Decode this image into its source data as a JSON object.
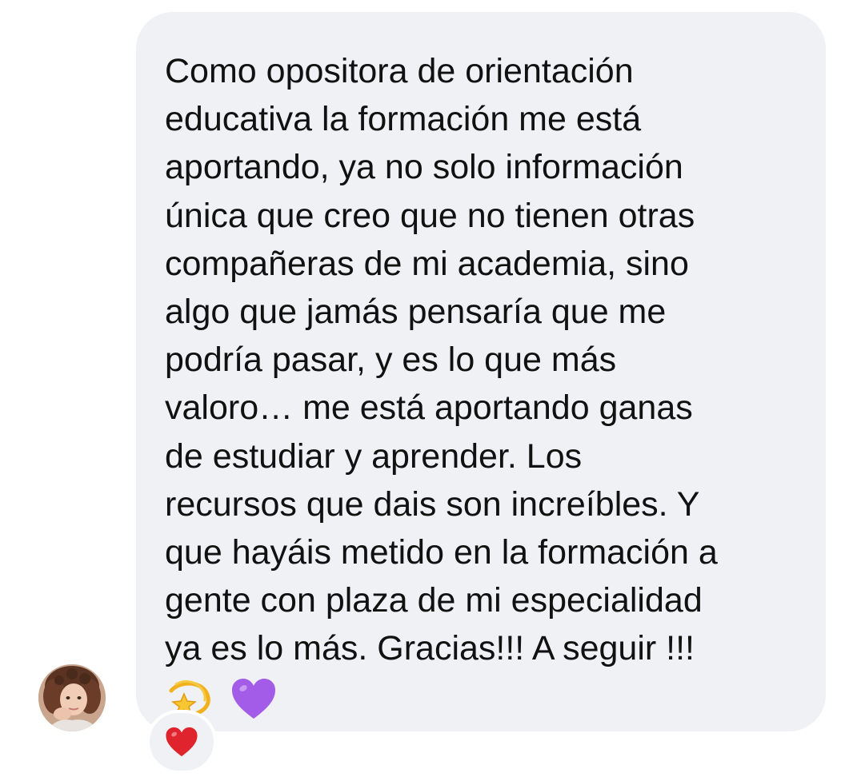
{
  "message": {
    "lines": [
      "Como opositora de orientación",
      "educativa la formación me está",
      "aportando, ya no solo información",
      "única que creo que no tienen otras",
      "compañeras de mi academia, sino",
      "algo que jamás pensaría que me",
      "podría pasar, y es lo que más",
      "valoro… me está aportando ganas",
      "de estudiar y aprender. Los",
      "recursos que dais son increíbles. Y",
      "que hayáis metido en la formación a",
      "gente con plaza de mi especialidad",
      "ya es lo más. Gracias!!! A seguir !!!"
    ],
    "emojis": [
      "dizzy-star-icon",
      "purple-heart-icon"
    ],
    "bubble_color": "#eff1f4",
    "text_color": "#111111"
  },
  "reaction": {
    "icon": "red-heart-icon",
    "color": "#e0242e"
  },
  "avatar": {
    "icon": "user-avatar"
  }
}
